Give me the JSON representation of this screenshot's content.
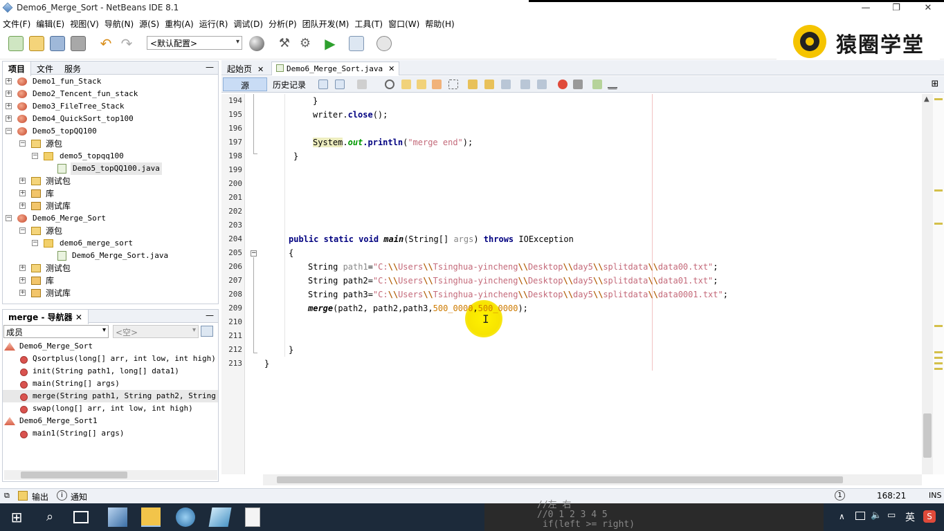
{
  "window": {
    "title": "Demo6_Merge_Sort - NetBeans IDE 8.1",
    "minimize": "—",
    "restore": "❐",
    "close": "✕"
  },
  "menu": [
    "文件(F)",
    "编辑(E)",
    "视图(V)",
    "导航(N)",
    "源(S)",
    "重构(A)",
    "运行(R)",
    "调试(D)",
    "分析(P)",
    "团队开发(M)",
    "工具(T)",
    "窗口(W)",
    "帮助(H)"
  ],
  "toolbar": {
    "config_value": "<默认配置>"
  },
  "logo": {
    "text": "猿圈学堂"
  },
  "projects_panel": {
    "tabs": [
      "项目",
      "文件",
      "服务"
    ],
    "minimize": "—",
    "items": [
      "Demo1_fun_Stack",
      "Demo2_Tencent_fun_stack",
      "Demo3_FileTree_Stack",
      "Demo4_QuickSort_top100",
      "Demo5_topQQ100",
      "源包",
      "demo5_topqq100",
      "Demo5_topQQ100.java",
      "测试包",
      "库",
      "测试库",
      "Demo6_Merge_Sort",
      "源包",
      "demo6_merge_sort",
      "Demo6_Merge_Sort.java",
      "测试包",
      "库",
      "测试库"
    ]
  },
  "navigator": {
    "tab": "merge - 导航器",
    "close": "✕",
    "minimize": "—",
    "filter_value": "成员",
    "filter2_value": "<空>",
    "items": [
      {
        "name": "Demo6_Merge_Sort",
        "sig": ""
      },
      {
        "name": "Qsortplus",
        "sig": "(long[] arr, int low, int high)"
      },
      {
        "name": "init",
        "sig": "(String path1, long[] data1)"
      },
      {
        "name": "main",
        "sig": "(String[] args)"
      },
      {
        "name": "merge",
        "sig": "(String path1, String path2, String outp"
      },
      {
        "name": "swap",
        "sig": "(long[] arr, int low, int high)"
      },
      {
        "name": "Demo6_Merge_Sort1",
        "sig": ""
      },
      {
        "name": "main1",
        "sig": "(String[] args)"
      }
    ]
  },
  "editor": {
    "tabs": [
      {
        "label": "起始页",
        "close": "✕"
      },
      {
        "label": "Demo6_Merge_Sort.java",
        "close": "✕"
      }
    ],
    "source_label": "源",
    "history_label": "历史记录",
    "line_numbers": [
      "194",
      "195",
      "196",
      "197",
      "198",
      "199",
      "200",
      "201",
      "202",
      "203",
      "204",
      "205",
      "206",
      "207",
      "208",
      "209",
      "210",
      "211",
      "212",
      "213"
    ]
  },
  "code": {
    "l194": "}",
    "l195_a": "writer.",
    "l195_b": "close",
    "l195_c": "();",
    "l197_sys": "System",
    "l197_dot": ".",
    "l197_out": "out",
    "l197_println": ".println",
    "l197_open": "(",
    "l197_str": "\"merge end\"",
    "l197_close": ");",
    "l198": "}",
    "l204_kw": "public static void ",
    "l204_main": "main",
    "l204_params": "(String[] ",
    "l204_args": "args",
    "l204_close": ") ",
    "l204_throws": "throws",
    "l204_exc": " IOException",
    "l205": "{",
    "path_type": "String ",
    "p1_name": "path1",
    "p2_name": "path2",
    "p3_name": "path3",
    "eq": "=",
    "s_open": "\"C:",
    "s_users": "Users",
    "s_user": "Tsinghua-yincheng",
    "s_desktop": "Desktop",
    "s_day": "day5",
    "s_split": "splitdata",
    "esc": "\\\\",
    "f1": "data00.txt\"",
    "f2": "data01.txt\"",
    "f3": "data0001.txt\"",
    "semi": ";",
    "l209_merge": "merge",
    "l209_args": "(path2, path2,path3,",
    "l209_n1": "500_0000",
    "l209_comma": ",",
    "l209_n2": "500_0000",
    "l209_close": ");",
    "l212": "}",
    "l213": "}"
  },
  "statusbar": {
    "output": "输出",
    "notify": "通知",
    "info": "1",
    "position": "168:21",
    "mode": "INS"
  },
  "taskbar": {
    "desk_line1": "//左          右",
    "desk_line2": "//0  1  2  3 4  5",
    "desk_line3": "if(left >= right)",
    "ime": "英",
    "ime_s": "S"
  }
}
